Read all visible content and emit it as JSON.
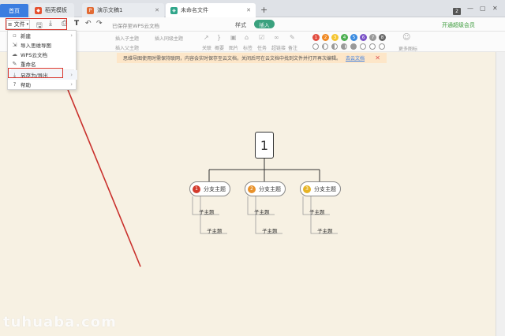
{
  "tabs": [
    {
      "label": "首页"
    },
    {
      "label": "稻壳模板"
    },
    {
      "label": "演示文稿1"
    },
    {
      "label": "未命名文件"
    }
  ],
  "tab_icons": [
    "wps-logo-icon",
    "daoke-icon",
    "ppt-icon",
    "mindmap-icon"
  ],
  "colors": {
    "home_tab": "#3b7de0",
    "accent_green": "#3aa17e",
    "red_box": "#d9342b",
    "arrow": "#c9302c",
    "canvas_bg": "#f7f1e3",
    "notice_bg": "#fde6c8"
  },
  "window": {
    "badge": "2"
  },
  "toolbar": {
    "file_label": "文件",
    "saved_status": "已保存至WPS云文档",
    "style_tab": "样式",
    "insert_tab": "插入",
    "vip_label": "开通超级会员"
  },
  "ribbon": {
    "insert_child": "插入子主题",
    "insert_sibling": "插入同级主题",
    "insert_parent": "插入父主题",
    "labels": [
      "关联",
      "概要",
      "图片",
      "标签",
      "任务",
      "超链接",
      "备注"
    ],
    "more_icons": "更多图标",
    "numbers": [
      "1",
      "2",
      "3",
      "4",
      "5",
      "6",
      "7",
      "8"
    ],
    "number_colors": [
      "#e24c3f",
      "#f08a24",
      "#f5c531",
      "#4caf50",
      "#3b8be0",
      "#7a52c7",
      "#999999",
      "#666666"
    ]
  },
  "notice": {
    "text": "思维导图使用时需保持联网，内容会实时保存至云文档，关闭后可在云文档中找到文件并打开再次编辑。",
    "link": "去云文档"
  },
  "file_menu": {
    "items": [
      {
        "label": "新建",
        "icon": "new-file-icon",
        "has_submenu": true
      },
      {
        "label": "导入思维导图",
        "icon": "import-icon",
        "has_submenu": false
      },
      {
        "label": "WPS云文档",
        "icon": "cloud-icon",
        "has_submenu": false
      },
      {
        "label": "重命名",
        "icon": "rename-icon",
        "has_submenu": false
      },
      {
        "label": "另存为/导出",
        "icon": "download-icon",
        "has_submenu": true
      },
      {
        "label": "帮助",
        "icon": "help-icon",
        "has_submenu": true
      }
    ]
  },
  "mindmap": {
    "root": "1",
    "branches": [
      {
        "num": "1",
        "label": "分支主题",
        "color": "#d33a2c",
        "subs": [
          "子主题",
          "子主题"
        ]
      },
      {
        "num": "2",
        "label": "分支主题",
        "color": "#e8922c",
        "subs": [
          "子主题",
          "子主题"
        ]
      },
      {
        "num": "3",
        "label": "分支主题",
        "color": "#e6b325",
        "subs": [
          "子主题",
          "子主题"
        ]
      }
    ]
  },
  "watermark": "tuhuaba.com"
}
